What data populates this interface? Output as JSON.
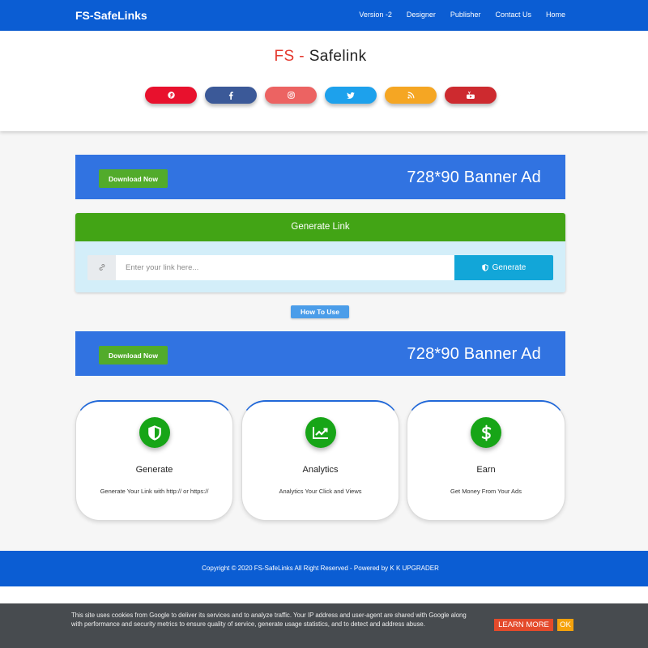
{
  "nav": {
    "brand": "FS-SafeLinks",
    "links": [
      "Version -2",
      "Designer",
      "Publisher",
      "Contact Us",
      "Home"
    ]
  },
  "header": {
    "title_prefix": "FS -",
    "title_main": "Safelink",
    "social": [
      {
        "icon": "pinterest-icon",
        "color": "#e8112d"
      },
      {
        "icon": "facebook-icon",
        "color": "#3b5998"
      },
      {
        "icon": "instagram-icon",
        "color": "#ec6362"
      },
      {
        "icon": "twitter-icon",
        "color": "#1da1ec"
      },
      {
        "icon": "rss-icon",
        "color": "#f5a623"
      },
      {
        "icon": "youtube-icon",
        "color": "#cd2a2f"
      }
    ]
  },
  "banner_top": {
    "button": "Download Now",
    "text": "728*90 Banner Ad"
  },
  "generator": {
    "title": "Generate Link",
    "addon_icon": "link-icon",
    "input_value": "",
    "placeholder": "Enter your link here...",
    "button_icon": "shield-icon",
    "button": "Generate"
  },
  "how_to_use": "How To Use",
  "banner_bottom": {
    "button": "Download Now",
    "text": "728*90 Banner Ad"
  },
  "features": [
    {
      "icon": "shield-icon",
      "title": "Generate",
      "desc": "Generate Your Link with http:// or https://"
    },
    {
      "icon": "chart-line-icon",
      "title": "Analytics",
      "desc": "Analytics Your Click and Views"
    },
    {
      "icon": "dollar-icon",
      "title": "Earn",
      "desc": "Get Money From Your Ads"
    }
  ],
  "footer": {
    "copyright": "Copyright © 2020 FS-SafeLinks All Right Reserved - Powered by K K UPGRADER"
  },
  "cookie": {
    "text": "This site uses cookies from Google to deliver its services and to analyze traffic. Your IP address and user-agent are shared with Google along with performance and security metrics to ensure quality of service, generate usage statistics, and to detect and address abuse.",
    "learn_more": "LEARN MORE",
    "ok": "OK"
  },
  "colors": {
    "nav_blue": "#0b5dd3",
    "banner_blue": "#3173e1",
    "header_green": "#42a415",
    "button_cyan": "#12a6d8",
    "title_red": "#e4392e",
    "icon_green": "#17a517",
    "cookie_bg": "#474b4f"
  }
}
